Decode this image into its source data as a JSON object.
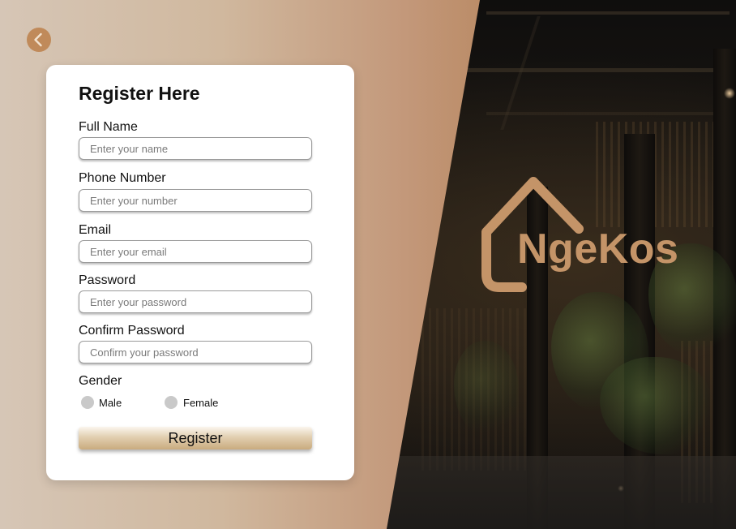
{
  "form": {
    "title": "Register Here",
    "full_name": {
      "label": "Full Name",
      "placeholder": "Enter your name"
    },
    "phone": {
      "label": "Phone Number",
      "placeholder": "Enter your number"
    },
    "email": {
      "label": "Email",
      "placeholder": "Enter your email"
    },
    "password": {
      "label": "Password",
      "placeholder": "Enter your password"
    },
    "confirm_password": {
      "label": "Confirm Password",
      "placeholder": "Confirm your password"
    },
    "gender": {
      "label": "Gender",
      "options": [
        "Male",
        "Female"
      ],
      "selected": null
    },
    "submit_label": "Register"
  },
  "brand": {
    "name": "NgeKos",
    "logo_icon": "house-outline-icon",
    "color": "#c49468"
  },
  "nav": {
    "back_icon": "chevron-left-icon"
  },
  "colors": {
    "accent": "#c08a5a",
    "panel_light": "#d6c6b6",
    "panel_dark": "#a87447",
    "card": "#ffffff"
  }
}
